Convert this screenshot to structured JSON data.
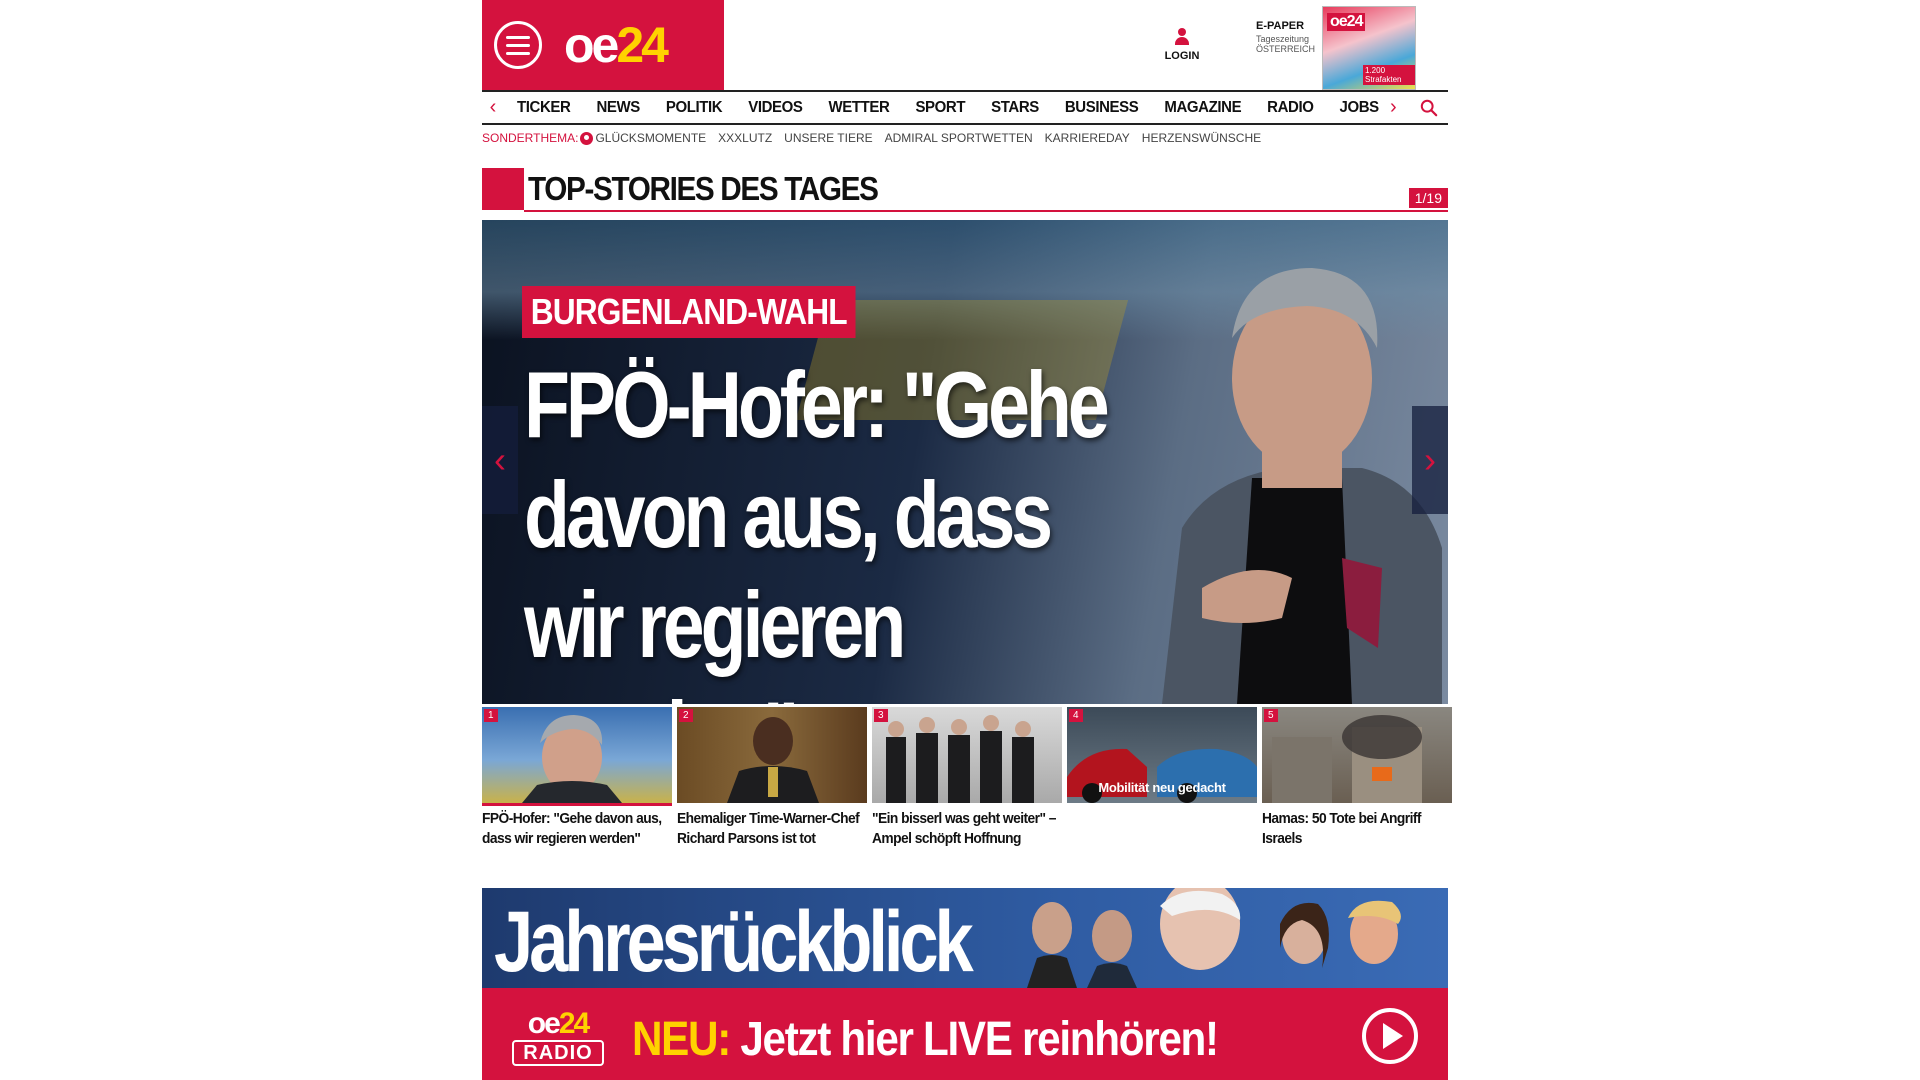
{
  "header": {
    "logo": {
      "text": "oe",
      "number": "24"
    },
    "login_label": "LOGIN",
    "epaper": {
      "title": "E-PAPER",
      "line1": "Tageszeitung",
      "line2": "ÖSTERREICH",
      "cover_logo": "oe24",
      "cover_strip": "1.200 Strafakten"
    }
  },
  "nav": {
    "items": [
      "TICKER",
      "NEWS",
      "POLITIK",
      "VIDEOS",
      "WETTER",
      "SPORT",
      "STARS",
      "BUSINESS",
      "MAGAZINE",
      "RADIO",
      "JOBS"
    ]
  },
  "subnav": {
    "label": "SONDERTHEMA:",
    "links": [
      "GLÜCKSMOMENTE",
      "XXXLUTZ",
      "UNSERE TIERE",
      "ADMIRAL SPORTWETTEN",
      "KARRIEREDAY",
      "HERZENSWÜNSCHE"
    ]
  },
  "section": {
    "title": "TOP-STORIES DES TAGES",
    "counter": "1/19"
  },
  "hero": {
    "kicker": "BURGENLAND-WAHL",
    "headline": "FPÖ-Hofer: \"Gehe davon aus, dass wir regieren werden\""
  },
  "thumbs": [
    {
      "num": "1",
      "caption": "FPÖ-Hofer: \"Gehe davon aus, dass wir regieren werden\"",
      "overlay": ""
    },
    {
      "num": "2",
      "caption": "Ehemaliger Time-Warner-Chef Richard Parsons ist tot",
      "overlay": ""
    },
    {
      "num": "3",
      "caption": "\"Ein bisserl was geht weiter\" – Ampel schöpft Hoffnung",
      "overlay": ""
    },
    {
      "num": "4",
      "caption": "",
      "overlay": "Mobilität neu gedacht"
    },
    {
      "num": "5",
      "caption": "Hamas: 50 Tote bei Angriff Israels",
      "overlay": ""
    }
  ],
  "banner": {
    "title": "Jahresrückblick"
  },
  "radio": {
    "logo_top": "oe",
    "logo_num": "24",
    "logo_bottom": "RADIO",
    "neu": "NEU:",
    "text": " Jetzt hier LIVE reinhören!"
  },
  "colors": {
    "brand": "#d4123e",
    "accent": "#ffd200"
  },
  "icons": [
    "menu-icon",
    "user-icon",
    "chevron-left-icon",
    "chevron-right-icon",
    "search-icon",
    "play-icon"
  ]
}
